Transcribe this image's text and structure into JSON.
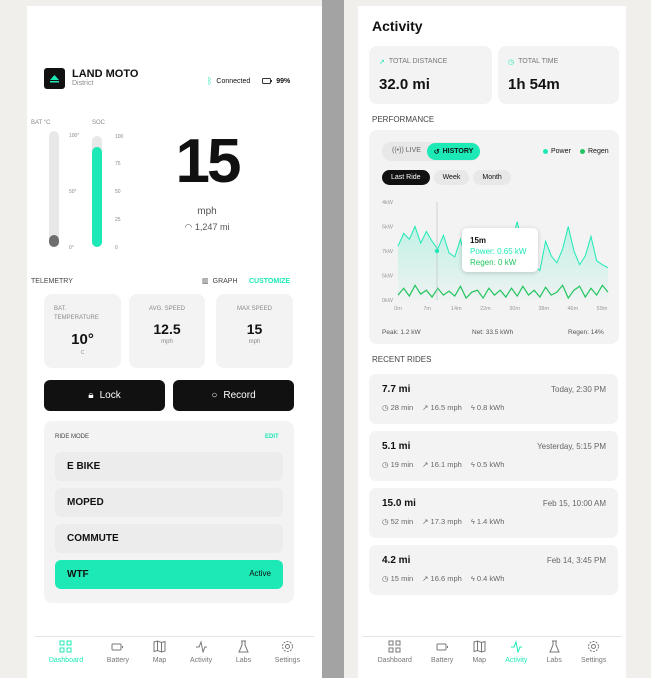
{
  "colors": {
    "accent": "#1de9b6",
    "regen": "#22c55e"
  },
  "dashboard": {
    "brand": "LAND MOTO",
    "model": "District",
    "connection": "Connected",
    "battery_pct": "99%",
    "gauges": {
      "bat_label": "BAT °C",
      "soc_label": "SOC",
      "bat_ticks": [
        "100°",
        "50°",
        "0°"
      ],
      "soc_ticks": [
        "100",
        "75",
        "50",
        "25",
        "0"
      ],
      "bat_level": 0.1,
      "soc_level": 0.9
    },
    "speed": "15",
    "speed_unit": "mph",
    "odometer": "1,247 mi",
    "telemetry_title": "TELEMETRY",
    "graph_label": "GRAPH",
    "customize_label": "CUSTOMIZE",
    "tiles": [
      {
        "label1": "BAT.",
        "label2": "TEMPERATURE",
        "value": "10°",
        "unit": "C"
      },
      {
        "label1": "AVG. SPEED",
        "label2": "",
        "value": "12.5",
        "unit": "mph"
      },
      {
        "label1": "MAX SPEED",
        "label2": "",
        "value": "15",
        "unit": "mph"
      }
    ],
    "lock_label": "Lock",
    "record_label": "Record",
    "ride_mode_title": "RIDE MODE",
    "edit_label": "EDIT",
    "modes": [
      "E BIKE",
      "MOPED",
      "COMMUTE",
      "WTF"
    ],
    "active_label": "Active"
  },
  "nav": [
    "Dashboard",
    "Battery",
    "Map",
    "Activity",
    "Labs",
    "Settings"
  ],
  "activity": {
    "title": "Activity",
    "total_distance_label": "TOTAL DISTANCE",
    "total_distance": "32.0 mi",
    "total_time_label": "TOTAL TIME",
    "total_time": "1h 54m",
    "performance_title": "PERFORMANCE",
    "live_label": "LIVE",
    "history_label": "HISTORY",
    "legend_power": "Power",
    "legend_regen": "Regen",
    "ranges": [
      "Last Ride",
      "Week",
      "Month"
    ],
    "tooltip": {
      "time": "15m",
      "power": "Power: 0.65 kW",
      "regen": "Regen: 0 kW"
    },
    "peak": "Peak: 1.2 kW",
    "net": "Net: 33.5 kWh",
    "regen_pct": "Regen: 14%",
    "recent_title": "RECENT RIDES",
    "rides": [
      {
        "distance": "7.7 mi",
        "date": "Today, 2:30 PM",
        "time": "28 min",
        "speed": "16.5 mph",
        "energy": "0.8 kWh"
      },
      {
        "distance": "5.1 mi",
        "date": "Yesterday, 5:15 PM",
        "time": "19 min",
        "speed": "16.1 mph",
        "energy": "0.5 kWh"
      },
      {
        "distance": "15.0 mi",
        "date": "Feb 15, 10:00 AM",
        "time": "52 min",
        "speed": "17.3 mph",
        "energy": "1.4 kWh"
      },
      {
        "distance": "4.2 mi",
        "date": "Feb 14, 3:45 PM",
        "time": "15 min",
        "speed": "16.6 mph",
        "energy": "0.4 kWh"
      }
    ]
  },
  "chart_data": {
    "type": "area",
    "y_ticks": [
      "4kW",
      "5kW",
      "7kW",
      "5kW",
      "0kW"
    ],
    "x_ticks": [
      "0m",
      "7m",
      "14m",
      "22m",
      "30m",
      "38m",
      "46m",
      "59m"
    ],
    "series": [
      {
        "name": "Power",
        "color": "#1de9b6",
        "values": [
          0.55,
          0.68,
          0.62,
          0.75,
          0.58,
          0.7,
          0.6,
          0.52,
          0.66,
          0.48,
          0.44,
          0.62,
          0.4,
          0.58,
          0.47,
          0.66,
          0.42,
          0.38,
          0.5,
          0.36,
          0.58,
          0.8,
          0.55,
          0.4,
          0.35,
          0.3,
          0.6,
          0.45,
          0.38,
          0.52,
          0.75,
          0.5,
          0.36,
          0.45,
          0.65,
          0.4,
          0.36,
          0.33
        ]
      },
      {
        "name": "Regen",
        "color": "#22c55e",
        "values": [
          0.05,
          0.12,
          0.04,
          0.15,
          0.06,
          0.1,
          0.03,
          0.12,
          0.05,
          0.09,
          0.04,
          0.14,
          0.02,
          0.08,
          0.1,
          0.02,
          0.12,
          0.05,
          0.1,
          0.03,
          0.12,
          0.04,
          0.14,
          0.05,
          0.1,
          0.03,
          0.13,
          0.05,
          0.08,
          0.15,
          0.02,
          0.1,
          0.14,
          0.03,
          0.12,
          0.05,
          0.15,
          0.08
        ]
      }
    ]
  }
}
